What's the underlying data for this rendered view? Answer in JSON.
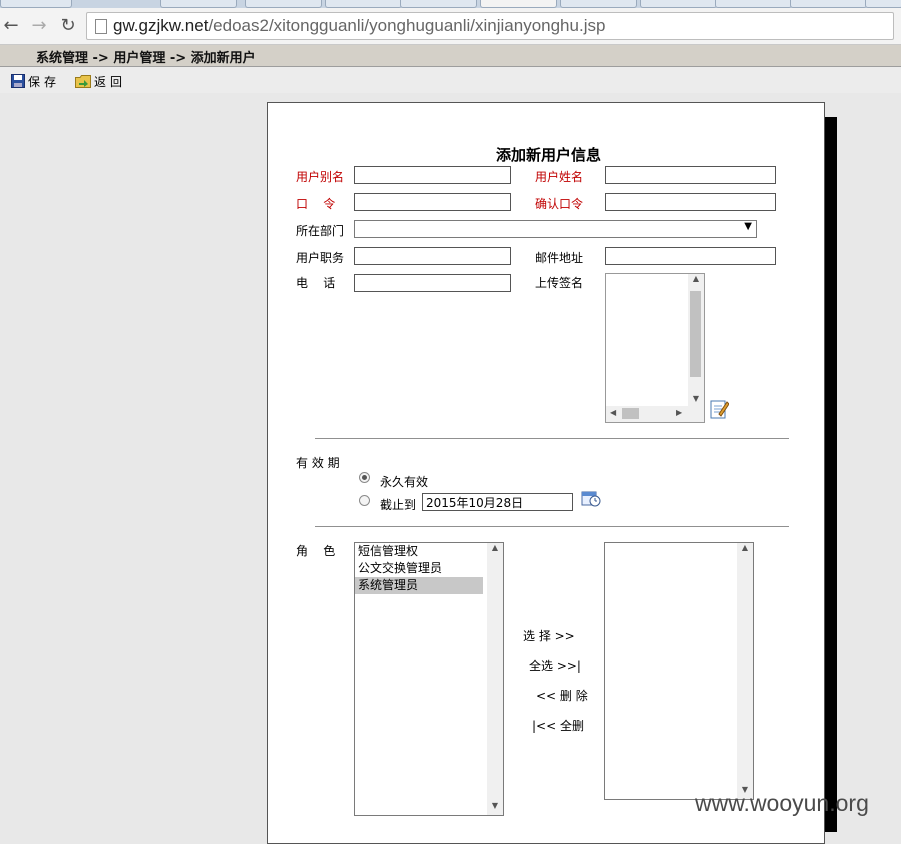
{
  "browser": {
    "url_host": "gw.gzjkw.net",
    "url_path": "/edoas2/xitongguanli/yonghuguanli/xinjianyonghu.jsp",
    "nav": {
      "back_icon": "back-arrow-icon",
      "forward_icon": "forward-arrow-icon",
      "reload_icon": "reload-icon"
    }
  },
  "breadcrumb": "系统管理 -> 用户管理 -> 添加新用户",
  "actions": {
    "save": "保存",
    "back": "返回"
  },
  "form": {
    "title": "添加新用户信息",
    "labels": {
      "alias": "用户别名",
      "name": "用户姓名",
      "password": "口    令",
      "confirm_password": "确认口令",
      "department": "所在部门",
      "position": "用户职务",
      "email": "邮件地址",
      "phone": "电    话",
      "signature": "上传签名",
      "validity": "有 效 期",
      "role": "角    色"
    },
    "values": {
      "alias": "",
      "name": "",
      "password": "",
      "confirm_password": "",
      "department": "",
      "position": "",
      "email": "",
      "phone": ""
    },
    "validity": {
      "permanent_label": "永久有效",
      "until_label": "截止到",
      "until_date": "2015年10月28日",
      "selected": "permanent"
    },
    "roles_available": [
      "短信管理权",
      "公文交换管理员",
      "系统管理员"
    ],
    "roles_selected_index": 2,
    "roles_chosen": [],
    "role_buttons": {
      "select": "选 择 >>",
      "select_all": "全选 >>|",
      "remove": "<< 删 除",
      "remove_all": "|<< 全删"
    }
  },
  "watermark": "www.wooyun.org",
  "colors": {
    "required_label": "#c00000",
    "crumb_bar": "#d4d0c8",
    "shadow": "#000000"
  }
}
